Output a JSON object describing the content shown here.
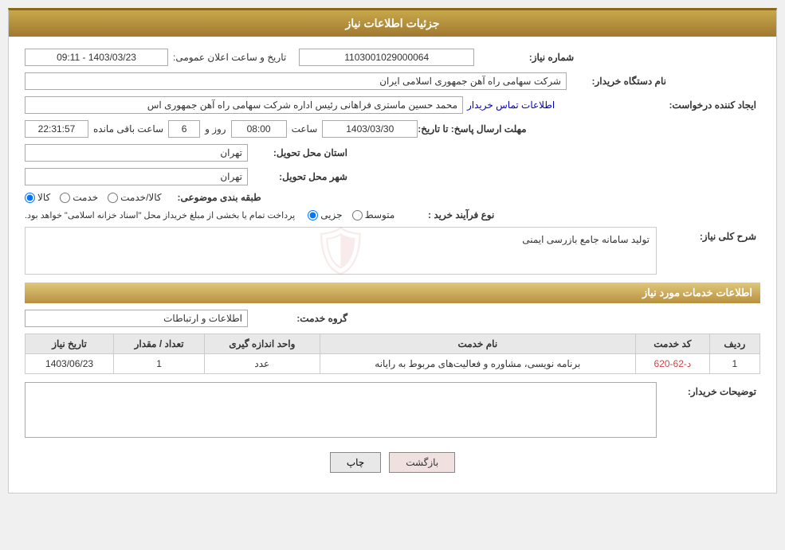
{
  "page": {
    "title": "جزئیات اطلاعات نیاز"
  },
  "header": {
    "need_number_label": "شماره نیاز:",
    "need_number_value": "1103001029000064",
    "announce_datetime_label": "تاریخ و ساعت اعلان عمومی:",
    "announce_datetime_value": "1403/03/23 - 09:11",
    "buyer_org_label": "نام دستگاه خریدار:",
    "buyer_org_value": "شرکت سهامی راه آهن جمهوری اسلامی ایران",
    "creator_label": "ایجاد کننده درخواست:",
    "creator_value": "محمد حسین ماستری فراهانی رئیس اداره شرکت سهامی راه آهن جمهوری اس",
    "contact_link": "اطلاعات تماس خریدار",
    "deadline_label": "مهلت ارسال پاسخ: تا تاریخ:",
    "deadline_date": "1403/03/30",
    "deadline_time_label": "ساعت",
    "deadline_time": "08:00",
    "deadline_days_label": "روز و",
    "deadline_days": "6",
    "deadline_remaining_label": "ساعت باقی مانده",
    "deadline_remaining": "22:31:57",
    "delivery_province_label": "استان محل تحویل:",
    "delivery_province_value": "تهران",
    "delivery_city_label": "شهر محل تحویل:",
    "delivery_city_value": "تهران",
    "category_label": "طبقه بندی موضوعی:",
    "category_options": [
      "کالا",
      "خدمت",
      "کالا/خدمت"
    ],
    "category_selected": "کالا",
    "process_type_label": "نوع فرآیند خرید :",
    "process_options": [
      "جزیی",
      "متوسط"
    ],
    "process_note": "پرداخت تمام یا بخشی از مبلغ خریداز محل \"اسناد خزانه اسلامی\" خواهد بود.",
    "need_description_label": "شرح کلی نیاز:",
    "need_description_value": "تولید سامانه جامع بازرسی ایمنی"
  },
  "services_section": {
    "title": "اطلاعات خدمات مورد نیاز",
    "service_group_label": "گروه خدمت:",
    "service_group_value": "اطلاعات و ارتباطات",
    "table": {
      "columns": [
        "ردیف",
        "کد خدمت",
        "نام خدمت",
        "واحد اندازه گیری",
        "تعداد / مقدار",
        "تاریخ نیاز"
      ],
      "rows": [
        {
          "row_num": "1",
          "service_code": "د-62-620",
          "service_name": "برنامه نویسی، مشاوره و فعالیت‌های مربوط به رایانه",
          "unit": "عدد",
          "quantity": "1",
          "need_date": "1403/06/23"
        }
      ]
    }
  },
  "buyer_notes_label": "توضیحات خریدار:",
  "buttons": {
    "print_label": "چاپ",
    "back_label": "بازگشت"
  }
}
